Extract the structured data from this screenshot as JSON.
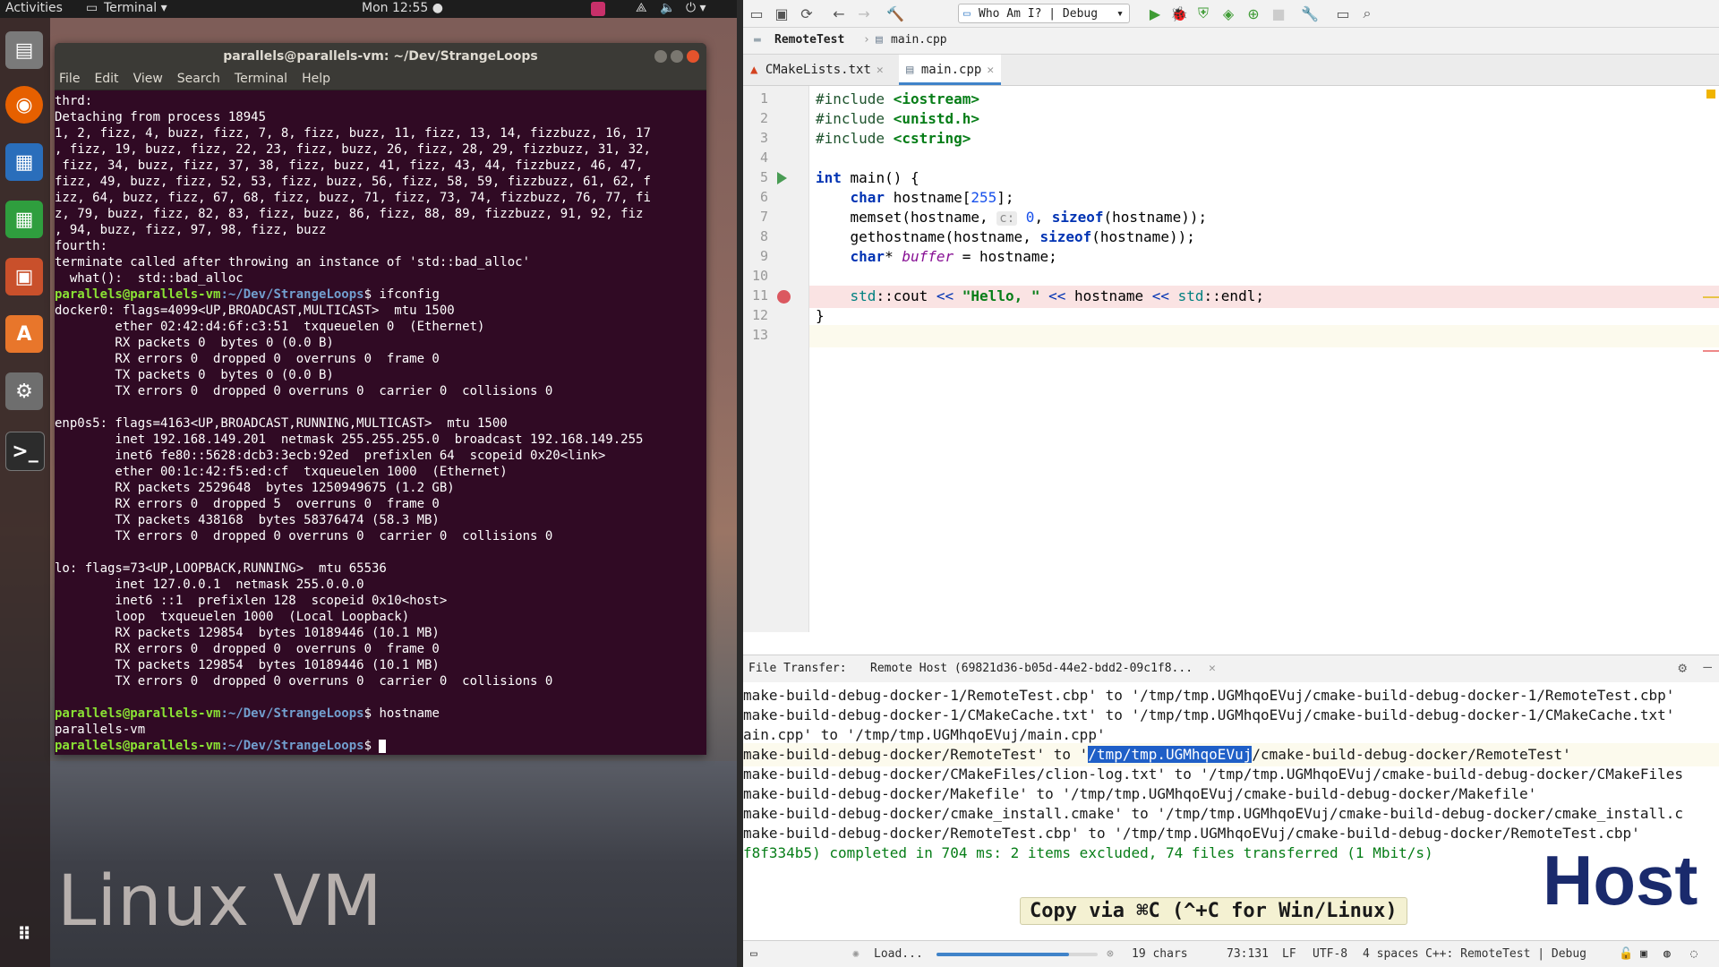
{
  "vm": {
    "topbar": {
      "activities": "Activities",
      "app_menu": "Terminal ▾",
      "clock": "Mon 12:55 ●"
    },
    "terminal": {
      "title": "parallels@parallels-vm: ~/Dev/StrangeLoops",
      "menu": [
        "File",
        "Edit",
        "View",
        "Search",
        "Terminal",
        "Help"
      ],
      "prompt_user": "parallels@parallels-vm",
      "prompt_path": ":~/Dev/StrangeLoops",
      "lines": [
        {
          "t": "thrd:"
        },
        {
          "t": "Detaching from process 18945"
        },
        {
          "t": "1, 2, fizz, 4, buzz, fizz, 7, 8, fizz, buzz, 11, fizz, 13, 14, fizzbuzz, 16, 17"
        },
        {
          "t": ", fizz, 19, buzz, fizz, 22, 23, fizz, buzz, 26, fizz, 28, 29, fizzbuzz, 31, 32,"
        },
        {
          "t": " fizz, 34, buzz, fizz, 37, 38, fizz, buzz, 41, fizz, 43, 44, fizzbuzz, 46, 47,"
        },
        {
          "t": "fizz, 49, buzz, fizz, 52, 53, fizz, buzz, 56, fizz, 58, 59, fizzbuzz, 61, 62, f"
        },
        {
          "t": "izz, 64, buzz, fizz, 67, 68, fizz, buzz, 71, fizz, 73, 74, fizzbuzz, 76, 77, fi"
        },
        {
          "t": "z, 79, buzz, fizz, 82, 83, fizz, buzz, 86, fizz, 88, 89, fizzbuzz, 91, 92, fiz"
        },
        {
          "t": ", 94, buzz, fizz, 97, 98, fizz, buzz"
        },
        {
          "t": "fourth:"
        },
        {
          "t": "terminate called after throwing an instance of 'std::bad_alloc'"
        },
        {
          "t": "  what():  std::bad_alloc"
        },
        {
          "p": true,
          "t": "$ ifconfig"
        },
        {
          "t": "docker0: flags=4099<UP,BROADCAST,MULTICAST>  mtu 1500"
        },
        {
          "t": "        ether 02:42:d4:6f:c3:51  txqueuelen 0  (Ethernet)"
        },
        {
          "t": "        RX packets 0  bytes 0 (0.0 B)"
        },
        {
          "t": "        RX errors 0  dropped 0  overruns 0  frame 0"
        },
        {
          "t": "        TX packets 0  bytes 0 (0.0 B)"
        },
        {
          "t": "        TX errors 0  dropped 0 overruns 0  carrier 0  collisions 0"
        },
        {
          "t": ""
        },
        {
          "t": "enp0s5: flags=4163<UP,BROADCAST,RUNNING,MULTICAST>  mtu 1500"
        },
        {
          "t": "        inet 192.168.149.201  netmask 255.255.255.0  broadcast 192.168.149.255"
        },
        {
          "t": "        inet6 fe80::5628:dcb3:3ecb:92ed  prefixlen 64  scopeid 0x20<link>"
        },
        {
          "t": "        ether 00:1c:42:f5:ed:cf  txqueuelen 1000  (Ethernet)"
        },
        {
          "t": "        RX packets 2529648  bytes 1250949675 (1.2 GB)"
        },
        {
          "t": "        RX errors 0  dropped 5  overruns 0  frame 0"
        },
        {
          "t": "        TX packets 438168  bytes 58376474 (58.3 MB)"
        },
        {
          "t": "        TX errors 0  dropped 0 overruns 0  carrier 0  collisions 0"
        },
        {
          "t": ""
        },
        {
          "t": "lo: flags=73<UP,LOOPBACK,RUNNING>  mtu 65536"
        },
        {
          "t": "        inet 127.0.0.1  netmask 255.0.0.0"
        },
        {
          "t": "        inet6 ::1  prefixlen 128  scopeid 0x10<host>"
        },
        {
          "t": "        loop  txqueuelen 1000  (Local Loopback)"
        },
        {
          "t": "        RX packets 129854  bytes 10189446 (10.1 MB)"
        },
        {
          "t": "        RX errors 0  dropped 0  overruns 0  frame 0"
        },
        {
          "t": "        TX packets 129854  bytes 10189446 (10.1 MB)"
        },
        {
          "t": "        TX errors 0  dropped 0 overruns 0  carrier 0  collisions 0"
        },
        {
          "t": ""
        },
        {
          "p": true,
          "t": "$ hostname"
        },
        {
          "t": "parallels-vm"
        },
        {
          "p": true,
          "t": "$ ",
          "cursor": true
        }
      ]
    },
    "caption": "Linux VM"
  },
  "ide": {
    "run_config": "Who Am I? | Debug",
    "breadcrumbs": [
      "RemoteTest",
      "main.cpp"
    ],
    "tabs": [
      {
        "label": "CMakeLists.txt",
        "active": false
      },
      {
        "label": "main.cpp",
        "active": true
      }
    ],
    "code": [
      {
        "n": "1",
        "h": "<span class='pp'>#include</span> <span class='inc'>&lt;iostream&gt;</span>"
      },
      {
        "n": "2",
        "h": "<span class='pp'>#include</span> <span class='inc'>&lt;unistd.h&gt;</span>"
      },
      {
        "n": "3",
        "h": "<span class='pp'>#include</span> <span class='inc'>&lt;cstring&gt;</span>"
      },
      {
        "n": "4",
        "h": ""
      },
      {
        "n": "5",
        "h": "<span class='kw'>int</span> main() {",
        "run": true
      },
      {
        "n": "6",
        "h": "    <span class='kw'>char</span> hostname[<span class='num'>255</span>];"
      },
      {
        "n": "7",
        "h": "    memset(hostname, <span class='hint'>c:</span> <span class='num'>0</span>, <span class='kw'>sizeof</span>(hostname));"
      },
      {
        "n": "8",
        "h": "    gethostname(hostname, <span class='kw'>sizeof</span>(hostname));"
      },
      {
        "n": "9",
        "h": "    <span class='kw'>char</span>* <span class='dim'>buffer</span> = hostname;"
      },
      {
        "n": "10",
        "h": ""
      },
      {
        "n": "11",
        "h": "    <span class='ns'>std</span>::cout <span class='op'>&lt;&lt;</span> <span class='str'>\"Hello, \"</span> <span class='op'>&lt;&lt;</span> hostname <span class='op'>&lt;&lt;</span> <span class='ns'>std</span>::endl;",
        "bp": true
      },
      {
        "n": "12",
        "h": "}"
      },
      {
        "n": "13",
        "h": "",
        "cur": true
      }
    ],
    "panel": {
      "label": "File Transfer:",
      "tab": "Remote Host (69821d36-b05d-44e2-bdd2-09c1f8...",
      "lines": [
        {
          "t": "make-build-debug-docker-1/RemoteTest.cbp' to '/tmp/tmp.UGMhqoEVuj/cmake-build-debug-docker-1/RemoteTest.cbp'"
        },
        {
          "t": "make-build-debug-docker-1/CMakeCache.txt' to '/tmp/tmp.UGMhqoEVuj/cmake-build-debug-docker-1/CMakeCache.txt'"
        },
        {
          "t": "ain.cpp' to '/tmp/tmp.UGMhqoEVuj/main.cpp'"
        },
        {
          "pre": "make-build-debug-docker/RemoteTest' to '",
          "sel": "/tmp/tmp.UGMhqoEVuj",
          "post": "/cmake-build-debug-docker/RemoteTest'",
          "cur": true
        },
        {
          "t": "make-build-debug-docker/CMakeFiles/clion-log.txt' to '/tmp/tmp.UGMhqoEVuj/cmake-build-debug-docker/CMakeFiles"
        },
        {
          "t": "make-build-debug-docker/Makefile' to '/tmp/tmp.UGMhqoEVuj/cmake-build-debug-docker/Makefile'"
        },
        {
          "t": "make-build-debug-docker/cmake_install.cmake' to '/tmp/tmp.UGMhqoEVuj/cmake-build-debug-docker/cmake_install.c"
        },
        {
          "t": "make-build-debug-docker/RemoteTest.cbp' to '/tmp/tmp.UGMhqoEVuj/cmake-build-debug-docker/RemoteTest.cbp'"
        },
        {
          "t": "f8f334b5) completed in 704 ms: 2 items excluded, 74 files transferred (1 Mbit/s)",
          "green": true
        }
      ]
    },
    "copy_hint": "Copy via ⌘C (^+C for Win/Linux)",
    "caption": "Host",
    "status": {
      "loading": "Load...",
      "progress": 0.82,
      "chars": "19 chars",
      "position": "73:131",
      "line_sep": "LF",
      "encoding": "UTF-8",
      "indent": "4 spaces",
      "context": "C++: RemoteTest | Debug"
    }
  }
}
